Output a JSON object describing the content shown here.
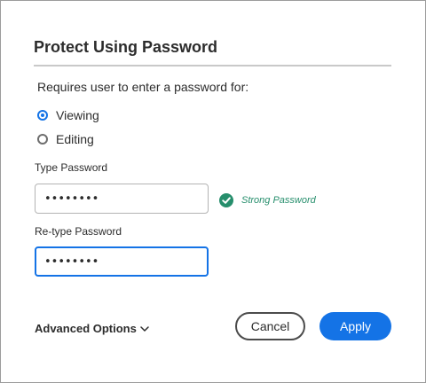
{
  "dialog": {
    "title": "Protect Using Password",
    "requires_text": "Requires user to enter a password for:",
    "options": [
      {
        "label": "Viewing",
        "selected": true
      },
      {
        "label": "Editing",
        "selected": false
      }
    ],
    "type_password_label": "Type Password",
    "type_password_value": "••••••••",
    "strength_text": "Strong Password",
    "retype_password_label": "Re-type Password",
    "retype_password_value": "••••••••",
    "advanced_label": "Advanced Options",
    "cancel_label": "Cancel",
    "apply_label": "Apply"
  },
  "colors": {
    "accent": "#1473e6",
    "success": "#268e6c"
  },
  "icons": {
    "strength": "check-circle-icon",
    "advanced": "chevron-down-icon"
  }
}
